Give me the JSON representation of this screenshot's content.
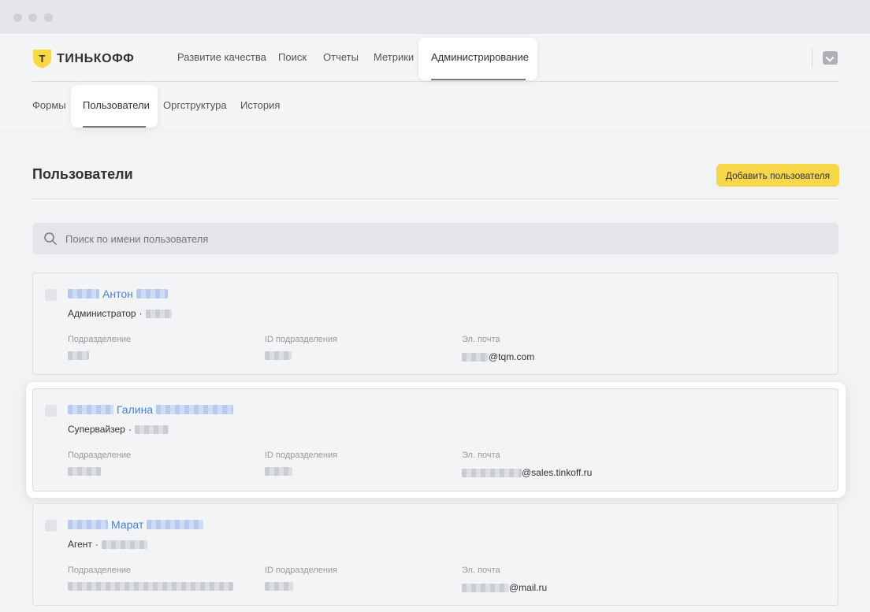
{
  "brand": {
    "name": "ТИНЬКОФФ",
    "logo_letter": "Т",
    "accent_color": "#f7d84a"
  },
  "top_nav": {
    "items": [
      {
        "label": "Развитие качества"
      },
      {
        "label": "Поиск"
      },
      {
        "label": "Отчеты"
      },
      {
        "label": "Метрики"
      },
      {
        "label": "Администрирование",
        "active": true
      }
    ]
  },
  "sub_nav": {
    "items": [
      {
        "label": "Формы"
      },
      {
        "label": "Пользователи",
        "active": true
      },
      {
        "label": "Оргструктура"
      },
      {
        "label": "История"
      }
    ]
  },
  "page": {
    "title": "Пользователи",
    "add_button": "Добавить пользователя"
  },
  "search": {
    "placeholder": "Поиск по имени пользователя",
    "value": "",
    "icon": "search-icon"
  },
  "columns": {
    "department": "Подразделение",
    "department_id": "ID подразделения",
    "email": "Эл. почта"
  },
  "users": [
    {
      "first_name": "Антон",
      "role": "Администратор",
      "email_domain": "@tqm.com"
    },
    {
      "first_name": "Галина",
      "role": "Супервайзер",
      "email_domain": "@sales.tinkoff.ru",
      "highlighted": true
    },
    {
      "first_name": "Марат",
      "role": "Агент",
      "email_domain": "@mail.ru"
    }
  ],
  "separator": "·"
}
